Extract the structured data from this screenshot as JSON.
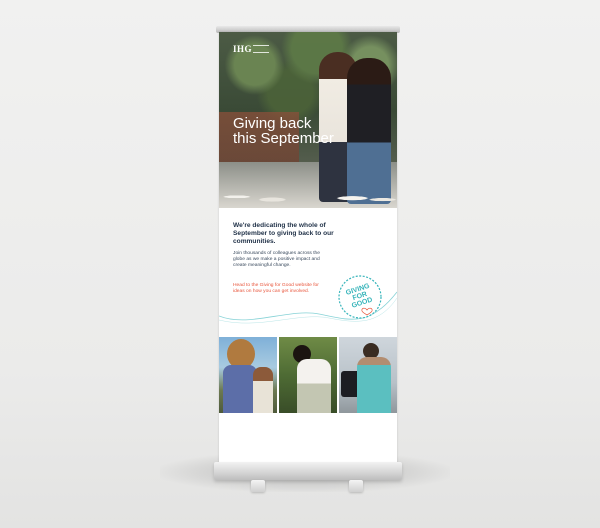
{
  "hero": {
    "logo": "IHG",
    "headline": "Giving back\nthis September"
  },
  "copy": {
    "intro": "We're dedicating the whole of September to giving back to our communities.",
    "body": "Join thousands of colleagues across the globe as we make a positive impact and create meaningful change.",
    "cta": "Head to the Giving for Good website for ideas on how you can get involved."
  },
  "badge": {
    "text": "GIVING\nFOR\nGOOD"
  },
  "colors": {
    "accent_teal": "#36b4ba",
    "cta_orange": "#e8553b",
    "navy_text": "#23344a"
  }
}
